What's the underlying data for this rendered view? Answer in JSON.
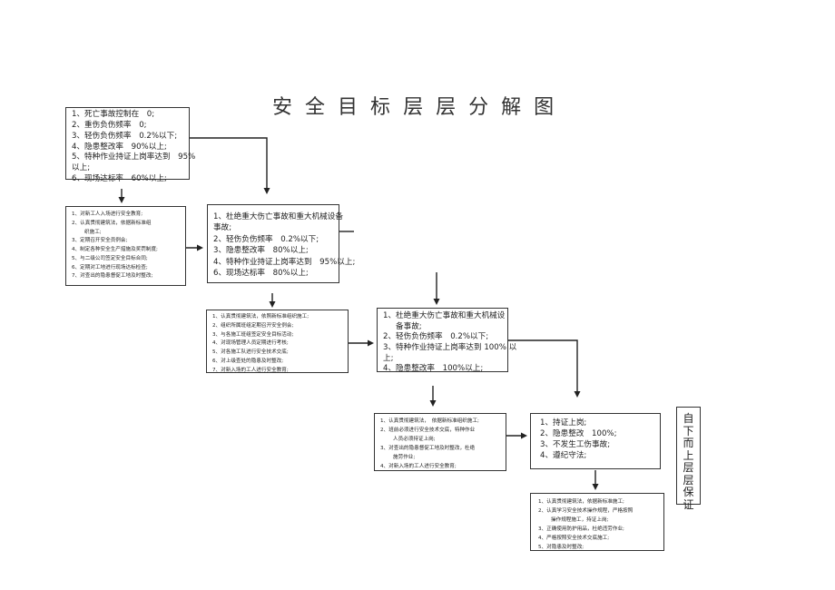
{
  "title": "安全目标层层分解图",
  "title_chars": [
    "安",
    "全",
    "目",
    "标",
    "层",
    "层",
    "分",
    "解",
    "图"
  ],
  "boxes": {
    "company_goals": {
      "lines": [
        {
          "text": "1、死亡事故控制在　0;"
        },
        {
          "text": "2、重伤负伤频率　0;"
        },
        {
          "text": "3、轻伤负伤频率　0.2%以下;"
        },
        {
          "text": "4、隐患整改率　90%以上;"
        },
        {
          "text": "5、特种作业持证上岗率达到　95%"
        },
        {
          "text": "以上;"
        },
        {
          "text": "6、现场达标率　60%以上;"
        }
      ]
    },
    "company_measures": {
      "lines": [
        {
          "text": "1、对新工人入场进行安全教育;"
        },
        {
          "text": "2、认真贯彻建筑法，依据新标准组"
        },
        {
          "text": "织施工;",
          "indent": true
        },
        {
          "text": "3、定期召开安全员例会;"
        },
        {
          "text": "4、制定各种安全生产措施及奖罚制度;"
        },
        {
          "text": "5、与二级公司签定安全目标合同;"
        },
        {
          "text": "6、定期对工地进行现场达标检查;"
        },
        {
          "text": "7、对查出的隐患督促工地及时整改;"
        }
      ]
    },
    "project_goals": {
      "lines": [
        {
          "text": "1、杜绝重大伤亡事故和重大机械设备"
        },
        {
          "text": "事故;"
        },
        {
          "text": "2、轻伤负伤频率　0.2%以下;"
        },
        {
          "text": "3、隐患整改率　80%以上;"
        },
        {
          "text": "4、特种作业持证上岗率达到　95%以上;"
        },
        {
          "text": "6、现场达标率　80%以上;"
        }
      ]
    },
    "project_measures": {
      "lines": [
        {
          "text": "1、认真贯彻建筑法，依照新标准组织施工;"
        },
        {
          "text": "2、组织所属班组定期召开安全例会;"
        },
        {
          "text": "3、与各施工班组签定安全目标活动;"
        },
        {
          "text": "4、对现场管理人员定期进行考核;"
        },
        {
          "text": "5、对各施工队进行安全技术交底;"
        },
        {
          "text": "6、对上级查处的隐患及时整改;"
        },
        {
          "text": "7、对新入场的工人进行安全教育;"
        }
      ]
    },
    "team_goals": {
      "lines": [
        {
          "text": "1、杜绝重大伤亡事故和重大机械设"
        },
        {
          "text": "备事故;",
          "indent": true
        },
        {
          "text": "2、轻伤负伤频率　0.2%以下;"
        },
        {
          "text": "3、特种作业持证上岗率达到 100% 以"
        },
        {
          "text": "上;"
        },
        {
          "text": "4、隐患整改率　100%以上;"
        }
      ]
    },
    "team_measures": {
      "lines": [
        {
          "text": "1、认真贯彻建筑法，　依据新标准组织施工;"
        },
        {
          "text": "2、班前必须进行安全技术交底，特种作业"
        },
        {
          "text": "人员必须持证上岗;",
          "indent": true
        },
        {
          "text": "3、对查出的隐患督促工地及时整改，杜绝"
        },
        {
          "text": "施劳作业;",
          "indent": true
        },
        {
          "text": "4、对新入场的工人进行安全教育;"
        }
      ]
    },
    "worker_goals": {
      "lines": [
        {
          "text": "1、持证上岗;"
        },
        {
          "text": "2、隐患整改　100%;"
        },
        {
          "text": "3、不发生工伤事故;"
        },
        {
          "text": "4、遵纪守法;"
        }
      ]
    },
    "worker_measures": {
      "lines": [
        {
          "text": "1、认真贯彻建筑法，依据新标准施工;"
        },
        {
          "text": "2、认真学习安全技术操作规程，严格按照"
        },
        {
          "text": "操作规程施工，持证上岗;",
          "indent": true
        },
        {
          "text": "3、正确使用防护用品，杜绝违劳作业;"
        },
        {
          "text": "4、严格按照安全技术交底施工;"
        },
        {
          "text": "5、对隐患及时整改;"
        }
      ]
    }
  },
  "side_label": {
    "text": "自下而上层层保证",
    "chars": [
      "自",
      "下",
      "而",
      "上",
      "层",
      "层",
      "保",
      "证"
    ]
  }
}
